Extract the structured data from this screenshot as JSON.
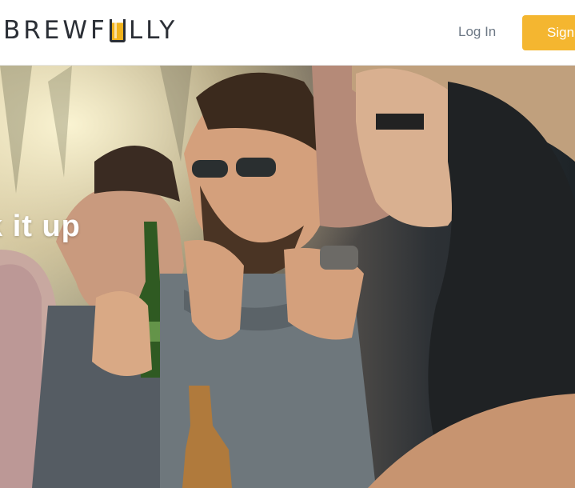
{
  "header": {
    "logo_text_left": "BREWF",
    "logo_text_right": "LLY",
    "logo_icon": "beer-glass-icon",
    "login_label": "Log In",
    "signup_label": "Sign"
  },
  "hero": {
    "headline": "k it up",
    "image": "friends-laughing-with-beer-photo"
  },
  "colors": {
    "accent": "#f4b630",
    "logo": "#2b2f36",
    "nav_text": "#6d7885"
  }
}
